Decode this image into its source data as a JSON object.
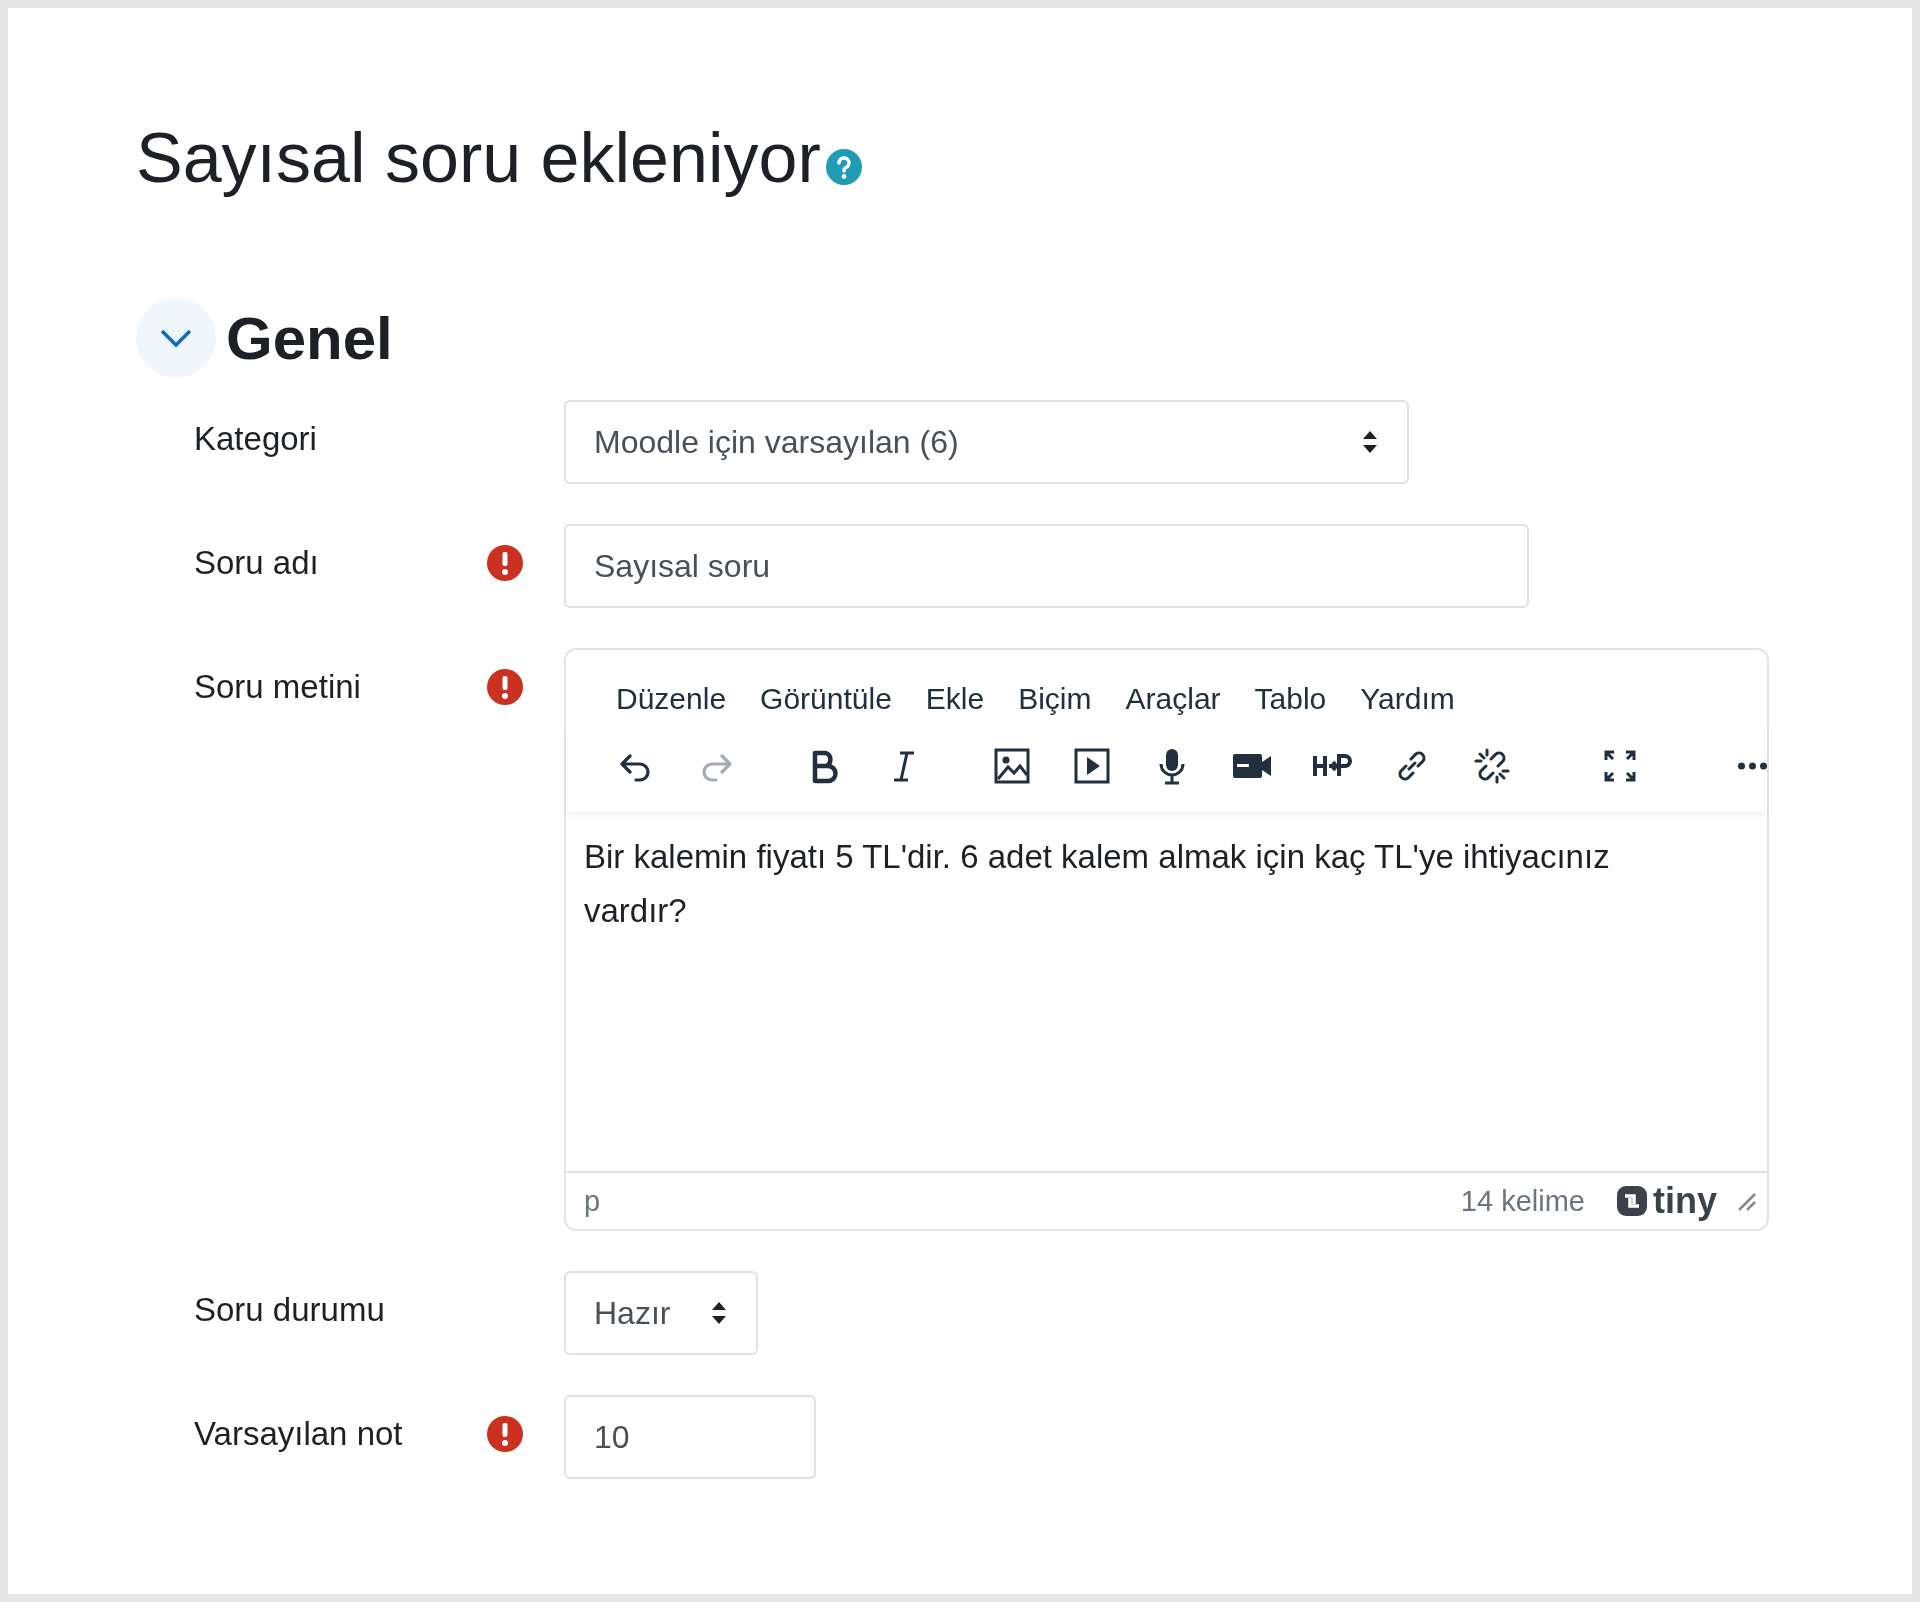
{
  "page": {
    "title": "Sayısal soru ekleniyor"
  },
  "section": {
    "title": "Genel",
    "expanded": true
  },
  "fields": [
    {
      "kind": "select",
      "label": "Kategori",
      "required": false,
      "value": "Moodle için varsayılan (6)"
    },
    {
      "kind": "text",
      "label": "Soru adı",
      "required": true,
      "value": "Sayısal soru"
    },
    {
      "kind": "editor",
      "label": "Soru metini",
      "required": true
    },
    {
      "kind": "select",
      "label": "Soru durumu",
      "required": false,
      "value": "Hazır"
    },
    {
      "kind": "text",
      "label": "Varsayılan not",
      "required": true,
      "value": "10"
    }
  ],
  "editor": {
    "menu": [
      "Düzenle",
      "Görüntüle",
      "Ekle",
      "Biçim",
      "Araçlar",
      "Tablo",
      "Yardım"
    ],
    "toolbar_groups": [
      [
        {
          "kind": "undo",
          "disabled": false
        },
        {
          "kind": "redo",
          "disabled": true
        }
      ],
      [
        {
          "kind": "bold",
          "disabled": false
        },
        {
          "kind": "italic",
          "disabled": false
        }
      ],
      [
        {
          "kind": "image",
          "disabled": false
        },
        {
          "kind": "media",
          "disabled": false
        },
        {
          "kind": "mic",
          "disabled": false
        },
        {
          "kind": "video",
          "disabled": false
        },
        {
          "kind": "h5p",
          "disabled": false
        },
        {
          "kind": "link",
          "disabled": false
        },
        {
          "kind": "unlink",
          "disabled": false
        }
      ],
      [
        {
          "kind": "fullscreen",
          "disabled": false
        }
      ],
      [
        {
          "kind": "more",
          "disabled": false
        }
      ]
    ],
    "content": "Bir kalemin fiyatı 5 TL'dir. 6 adet kalem almak için kaç TL'ye ihtiyacınız vardır?",
    "path": "p",
    "word_count": "14 kelime",
    "brand": "tiny"
  }
}
